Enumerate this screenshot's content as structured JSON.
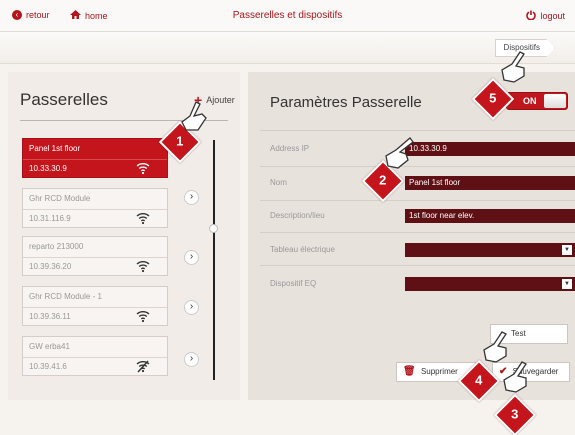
{
  "header": {
    "back_label": "retour",
    "home_label": "home",
    "title": "Passerelles et dispositifs",
    "logout_label": "logout"
  },
  "breadcrumb": {
    "current": "Dispositifs"
  },
  "gateways": {
    "title": "Passerelles",
    "add_label": "Ajouter",
    "items": [
      {
        "name": "Panel 1st floor",
        "ip": "10.33.30.9",
        "active": true,
        "wifi": "connected"
      },
      {
        "name": "Ghr RCD Module",
        "ip": "10.31.116.9",
        "active": false,
        "wifi": "connected"
      },
      {
        "name": "reparto 213000",
        "ip": "10.39.36.20",
        "active": false,
        "wifi": "connected"
      },
      {
        "name": "Ghr RCD Module - 1",
        "ip": "10.39.36.11",
        "active": false,
        "wifi": "connected"
      },
      {
        "name": "GW erba41",
        "ip": "10.39.41.6",
        "active": false,
        "wifi": "disconnected"
      }
    ]
  },
  "settings": {
    "title": "Paramètres Passerelle",
    "toggle_label": "ON",
    "fields": {
      "address_label": "Address IP",
      "address_value": "10.33.30.9",
      "name_label": "Nom",
      "name_value": "Panel 1st floor",
      "description_label": "Description/lieu",
      "description_value": "1st floor near elev.",
      "board_label": "Tableau électrique",
      "board_value": "",
      "device_label": "Dispositif EQ",
      "device_value": ""
    },
    "test_label": "Test",
    "delete_label": "Supprimer",
    "save_label": "Sauvegarder"
  },
  "callouts": [
    "1",
    "2",
    "3",
    "4",
    "5"
  ],
  "colors": {
    "accent": "#c4141c",
    "field_bg": "#5e1014"
  }
}
